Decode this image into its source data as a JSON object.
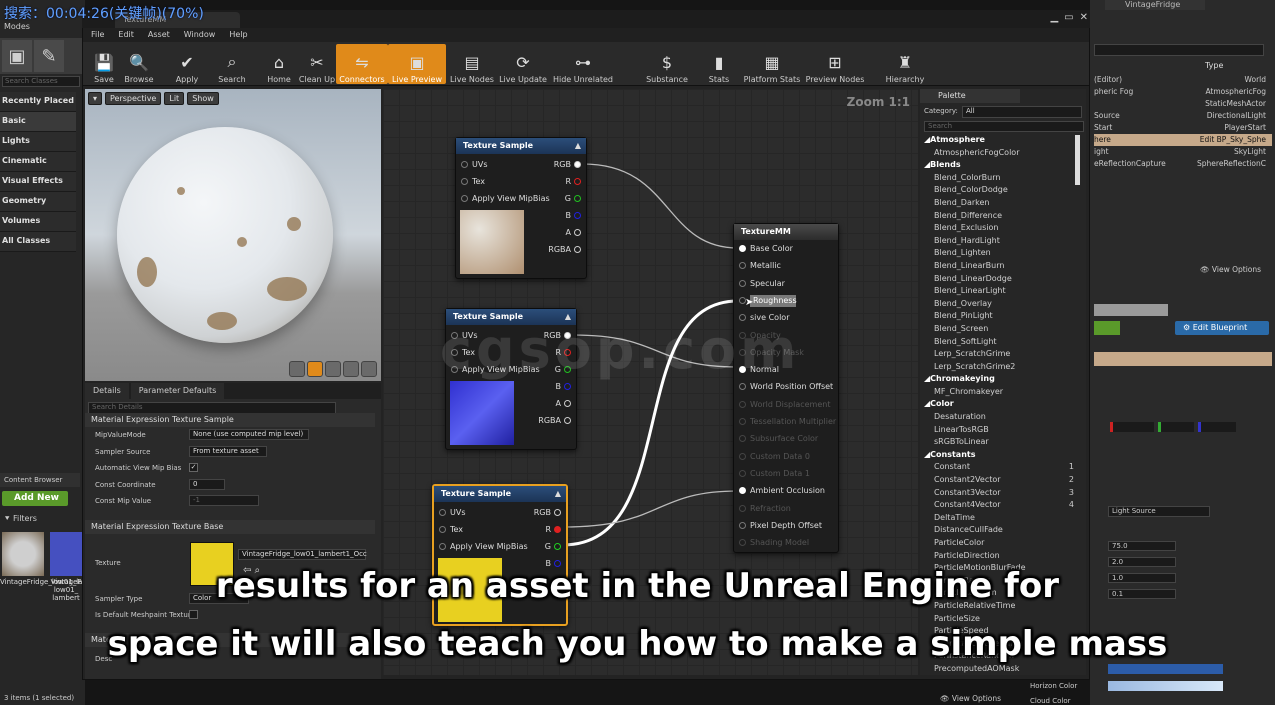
{
  "overlay": {
    "top_watermark": "搜索：00:04:26(关键帧)(70%)",
    "graph_watermark": "cgsop.com",
    "subtitle_line1": "results for an asset in the Unreal Engine for",
    "subtitle_line2": "space it will also teach you how to make a simple mass"
  },
  "left_panel": {
    "modes_title": "Modes",
    "search_placeholder": "Search Classes",
    "categories": [
      "Recently Placed",
      "Basic",
      "Lights",
      "Cinematic",
      "Visual Effects",
      "Geometry",
      "Volumes",
      "All Classes"
    ],
    "content_browser_tab": "Content Browser",
    "add_new": "Add New",
    "filters": "Filters",
    "thumb1_label": "VintageFridge_low01_lambert1_Base",
    "thumb2_label": "VintageF low01_ lambert",
    "items_count": "3 items (1 selected)"
  },
  "window": {
    "doc_tab": "TextureMM",
    "menu": [
      "File",
      "Edit",
      "Asset",
      "Window",
      "Help"
    ]
  },
  "toolbar": [
    {
      "label": "Save",
      "icon": "save-icon",
      "active": false
    },
    {
      "label": "Browse",
      "icon": "browse-icon",
      "active": false
    },
    {
      "label": "Apply",
      "icon": "apply-icon",
      "active": false
    },
    {
      "label": "Search",
      "icon": "search-icon",
      "active": false
    },
    {
      "label": "Home",
      "icon": "home-icon",
      "active": false
    },
    {
      "label": "Clean Up",
      "icon": "cleanup-icon",
      "active": false
    },
    {
      "label": "Connectors",
      "icon": "connectors-icon",
      "active": true
    },
    {
      "label": "Live Preview",
      "icon": "live-preview-icon",
      "active": true
    },
    {
      "label": "Live Nodes",
      "icon": "live-nodes-icon",
      "active": false
    },
    {
      "label": "Live Update",
      "icon": "live-update-icon",
      "active": false
    },
    {
      "label": "Hide Unrelated",
      "icon": "hide-unrelated-icon",
      "active": false
    },
    {
      "label": "Substance",
      "icon": "substance-icon",
      "active": false
    },
    {
      "label": "Stats",
      "icon": "stats-icon",
      "active": false
    },
    {
      "label": "Platform Stats",
      "icon": "platform-stats-icon",
      "active": false
    },
    {
      "label": "Preview Nodes",
      "icon": "preview-nodes-icon",
      "active": false
    },
    {
      "label": "Hierarchy",
      "icon": "hierarchy-icon",
      "active": false
    }
  ],
  "viewport": {
    "buttons": [
      "Perspective",
      "Lit",
      "Show"
    ]
  },
  "graph": {
    "zoom": "Zoom 1:1",
    "texture_node_title": "Texture Sample",
    "texture_inputs": [
      "UVs",
      "Tex",
      "Apply View MipBias"
    ],
    "texture_outputs": [
      "RGB",
      "R",
      "G",
      "B",
      "A",
      "RGBA"
    ],
    "main_node": {
      "title": "TextureMM",
      "pins": [
        {
          "label": "Base Color",
          "enabled": true
        },
        {
          "label": "Metallic",
          "enabled": true
        },
        {
          "label": "Specular",
          "enabled": true
        },
        {
          "label": "Roughness",
          "enabled": true
        },
        {
          "label": "Emissive Color",
          "enabled": true
        },
        {
          "label": "Opacity",
          "enabled": false
        },
        {
          "label": "Opacity Mask",
          "enabled": false
        },
        {
          "label": "Normal",
          "enabled": true
        },
        {
          "label": "World Position Offset",
          "enabled": true
        },
        {
          "label": "World Displacement",
          "enabled": false
        },
        {
          "label": "Tessellation Multiplier",
          "enabled": false
        },
        {
          "label": "Subsurface Color",
          "enabled": false
        },
        {
          "label": "Custom Data 0",
          "enabled": false
        },
        {
          "label": "Custom Data 1",
          "enabled": false
        },
        {
          "label": "Ambient Occlusion",
          "enabled": true
        },
        {
          "label": "Refraction",
          "enabled": false
        },
        {
          "label": "Pixel Depth Offset",
          "enabled": true
        },
        {
          "label": "Shading Model",
          "enabled": false
        }
      ]
    },
    "tooltip_text": "Roughness",
    "emissive_short": "sive Color"
  },
  "details": {
    "tab1": "Details",
    "tab2": "Parameter Defaults",
    "search_placeholder": "Search Details",
    "section1": "Material Expression Texture Sample",
    "rows": [
      {
        "label": "MipValueMode",
        "value": "None (use computed mip level)"
      },
      {
        "label": "Sampler Source",
        "value": "From texture asset"
      },
      {
        "label": "Automatic View Mip Bias",
        "value": "✓"
      },
      {
        "label": "Const Coordinate",
        "value": "0"
      },
      {
        "label": "Const Mip Value",
        "value": "-1"
      }
    ],
    "section2": "Material Expression Texture Base",
    "texture_label": "Texture",
    "texture_value": "VintageFridge_low01_lambert1_Occ",
    "sampler_type_label": "Sampler Type",
    "sampler_type_value": "Color",
    "meshpaint_label": "Is Default Meshpaint Texture",
    "section3": "Material",
    "desc_label": "Desc"
  },
  "palette": {
    "tab": "Palette",
    "category_label": "Category:",
    "category_value": "All",
    "search_placeholder": "Search",
    "items": [
      {
        "t": "Atmosphere",
        "h": true
      },
      {
        "t": "AtmosphericFogColor"
      },
      {
        "t": "Blends",
        "h": true
      },
      {
        "t": "Blend_ColorBurn"
      },
      {
        "t": "Blend_ColorDodge"
      },
      {
        "t": "Blend_Darken"
      },
      {
        "t": "Blend_Difference"
      },
      {
        "t": "Blend_Exclusion"
      },
      {
        "t": "Blend_HardLight"
      },
      {
        "t": "Blend_Lighten"
      },
      {
        "t": "Blend_LinearBurn"
      },
      {
        "t": "Blend_LinearDodge"
      },
      {
        "t": "Blend_LinearLight"
      },
      {
        "t": "Blend_Overlay"
      },
      {
        "t": "Blend_PinLight"
      },
      {
        "t": "Blend_Screen"
      },
      {
        "t": "Blend_SoftLight"
      },
      {
        "t": "Lerp_ScratchGrime"
      },
      {
        "t": "Lerp_ScratchGrime2"
      },
      {
        "t": "Chromakeying",
        "h": true
      },
      {
        "t": "MF_Chromakeyer"
      },
      {
        "t": "Color",
        "h": true
      },
      {
        "t": "Desaturation"
      },
      {
        "t": "LinearTosRGB"
      },
      {
        "t": "sRGBToLinear"
      },
      {
        "t": "Constants",
        "h": true
      },
      {
        "t": "Constant",
        "n": "1"
      },
      {
        "t": "Constant2Vector",
        "n": "2"
      },
      {
        "t": "Constant3Vector",
        "n": "3"
      },
      {
        "t": "Constant4Vector",
        "n": "4"
      },
      {
        "t": "DeltaTime"
      },
      {
        "t": "DistanceCullFade"
      },
      {
        "t": "ParticleColor"
      },
      {
        "t": "ParticleDirection"
      },
      {
        "t": "ParticleMotionBlurFade"
      },
      {
        "t": "ParticleRadius"
      },
      {
        "t": "ParticleRandom"
      },
      {
        "t": "ParticleRelativeTime"
      },
      {
        "t": "ParticleSize"
      },
      {
        "t": "ParticleSpeed"
      },
      {
        "t": "PerInstanceFadeAmount"
      },
      {
        "t": "PerInstanceRandom"
      },
      {
        "t": "PrecomputedAOMask"
      }
    ]
  },
  "right_panel": {
    "type_header": "Type",
    "rows": [
      {
        "name": "(Editor)",
        "type": "World"
      },
      {
        "name": "pheric Fog",
        "type": "AtmosphericFog"
      },
      {
        "name": "",
        "type": "StaticMeshActor"
      },
      {
        "name": "Source",
        "type": "DirectionalLight"
      },
      {
        "name": "Start",
        "type": "PlayerStart"
      },
      {
        "name": "here",
        "type": "Edit BP_Sky_Sphe",
        "sel": true
      },
      {
        "name": "ight",
        "type": "SkyLight"
      },
      {
        "name": "eReflectionCapture",
        "type": "SphereReflectionC"
      }
    ],
    "view_options": "View Options",
    "edit_blueprint": "Edit Blueprint",
    "light_source": "Light Source",
    "values": [
      "75.0",
      "2.0",
      "1.0",
      "0.1"
    ],
    "horizon_color": "Horizon Color",
    "cloud_color": "Cloud Color",
    "title_tab": "VintageFridge"
  }
}
